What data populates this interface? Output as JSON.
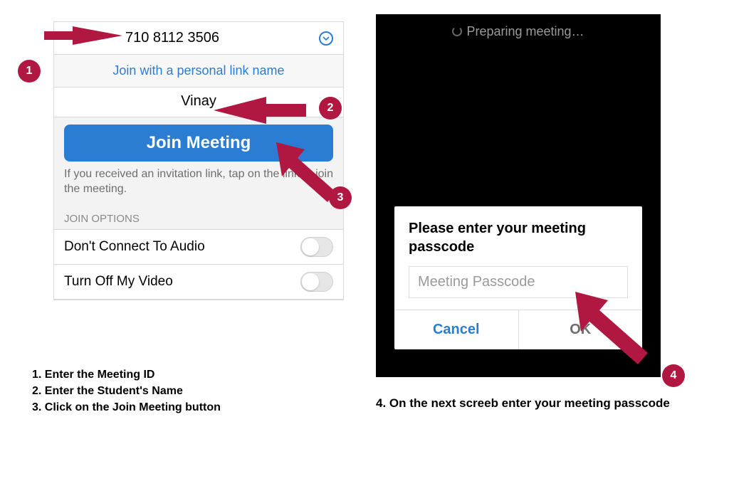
{
  "left": {
    "meeting_id": "710 8112 3506",
    "personal_link": "Join with a personal link name",
    "name": "Vinay",
    "join_button": "Join Meeting",
    "help_text": "If you received an invitation link, tap on the link to join the meeting.",
    "options_header": "JOIN OPTIONS",
    "option1": "Don't Connect To Audio",
    "option2": "Turn Off My Video"
  },
  "right": {
    "preparing": "Preparing meeting…",
    "modal_title": "Please enter your meeting passcode",
    "passcode_placeholder": "Meeting Passcode",
    "cancel": "Cancel",
    "ok": "OK"
  },
  "badges": {
    "b1": "1",
    "b2": "2",
    "b3": "3",
    "b4": "4"
  },
  "instructions": {
    "i1": "1. Enter the Meeting ID",
    "i2": "2. Enter the Student's Name",
    "i3": "3. Click on the Join Meeting button",
    "i4": "4. On the next screeb enter your meeting passcode"
  },
  "colors": {
    "accent": "#b01842",
    "primary": "#2b7cd3"
  }
}
